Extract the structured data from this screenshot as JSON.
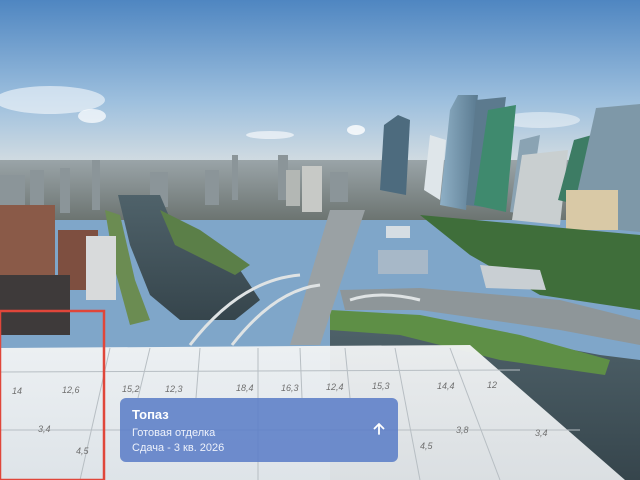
{
  "listing_card": {
    "title": "Топаз",
    "finish": "Готовая отделка",
    "completion": "Сдача - 3 кв. 2026",
    "expand_icon": "arrow-up-icon"
  },
  "floor_plan": {
    "room_areas": [
      "14",
      "12,6",
      "15,2",
      "12,3",
      "18,4",
      "16,3",
      "12,4",
      "15,3",
      "14,4",
      "12",
      "3,4",
      "4,5",
      "4,5",
      "3,8",
      "3,4"
    ]
  },
  "colors": {
    "card_bg": "#5c7ec7",
    "highlight_frame": "#e0463a",
    "sky": "#6f9bc6"
  }
}
